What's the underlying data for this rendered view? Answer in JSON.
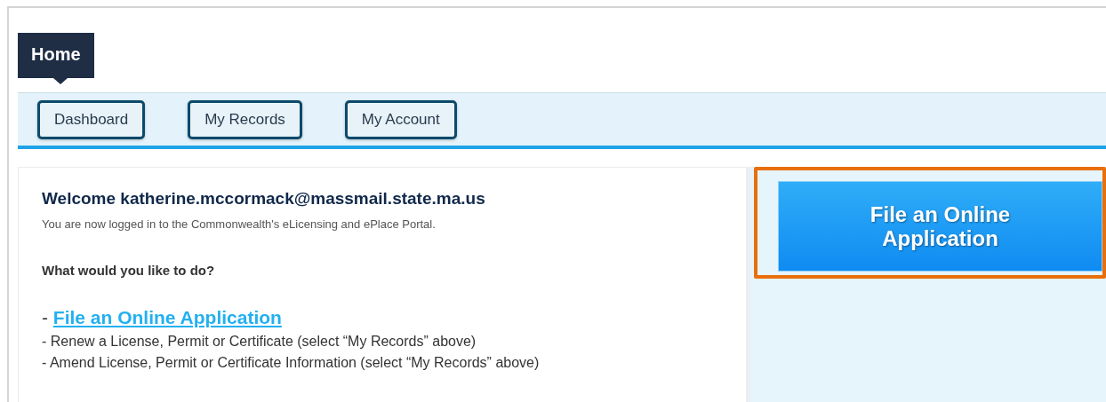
{
  "home_tab": {
    "label": "Home"
  },
  "nav_buttons": [
    "Dashboard",
    "My Records",
    "My Account"
  ],
  "welcome": {
    "title": "Welcome katherine.mccormack@massmail.state.ma.us",
    "subtitle": "You are now logged in to the Commonwealth's eLicensing and ePlace Portal."
  },
  "question": "What would you like to do?",
  "actions": [
    {
      "kind": "link",
      "prefix": "- ",
      "text": "File an Online Application"
    },
    {
      "kind": "text",
      "text": "- Renew a License, Permit or Certificate (select “My Records” above)"
    },
    {
      "kind": "text",
      "text": "- Amend License, Permit or Certificate Information (select “My Records” above)"
    }
  ],
  "side_button": {
    "label": "File an Online Application",
    "highlighted": true
  }
}
